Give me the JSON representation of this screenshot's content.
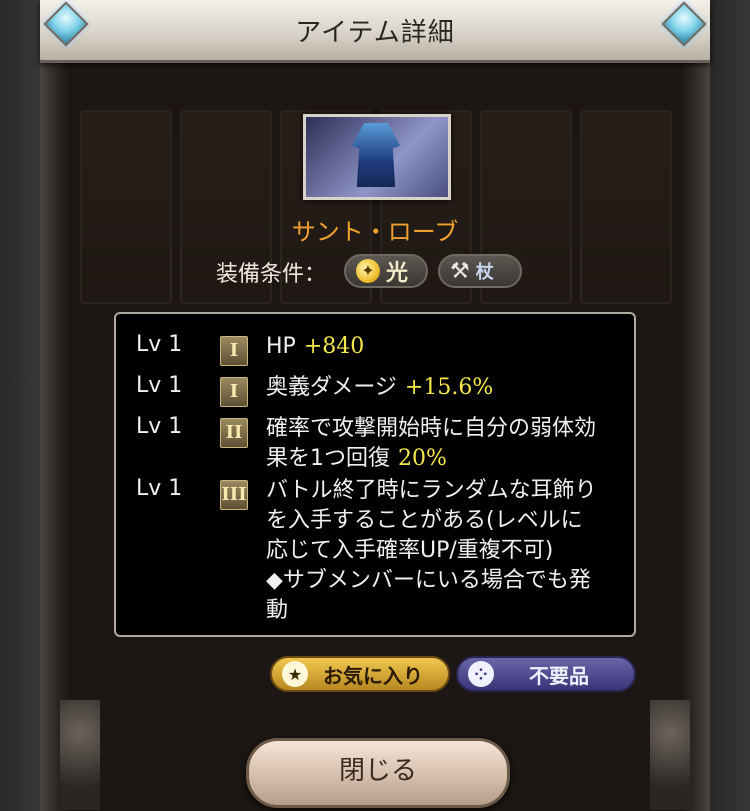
{
  "dialog": {
    "title": "アイテム詳細",
    "item_name": "サント・ローブ",
    "equip_label": "装備条件：",
    "element_label": "光",
    "weapon_label": "杖",
    "stats": [
      {
        "level": "Lv 1",
        "tier": "I",
        "text": "HP",
        "value": "+840"
      },
      {
        "level": "Lv 1",
        "tier": "I",
        "text": "奥義ダメージ",
        "value": "+15.6%"
      },
      {
        "level": "Lv 1",
        "tier": "II",
        "text_line1": "確率で攻撃開始時に自分の弱体効",
        "text_line2": "果を1つ回復",
        "value": "20%"
      },
      {
        "level": "Lv 1",
        "tier": "III",
        "lines": [
          "バトル終了時にランダムな耳飾り",
          "を入手することがある(レベルに",
          "応じて入手確率UP/重複不可)",
          "◆サブメンバーにいる場合でも発",
          "動"
        ]
      }
    ],
    "favorite_label": "お気に入り",
    "unneeded_label": "不要品",
    "close_label": "閉じる"
  },
  "colors": {
    "item_name": "#f0a030",
    "stat_value": "#f5e84a",
    "favorite_button": "#e0b040",
    "unneeded_button": "#5a5498"
  },
  "icons": {
    "element": "light-element-icon",
    "weapon": "staff-icon",
    "favorite": "star-icon",
    "unneeded": "dice-icon"
  }
}
